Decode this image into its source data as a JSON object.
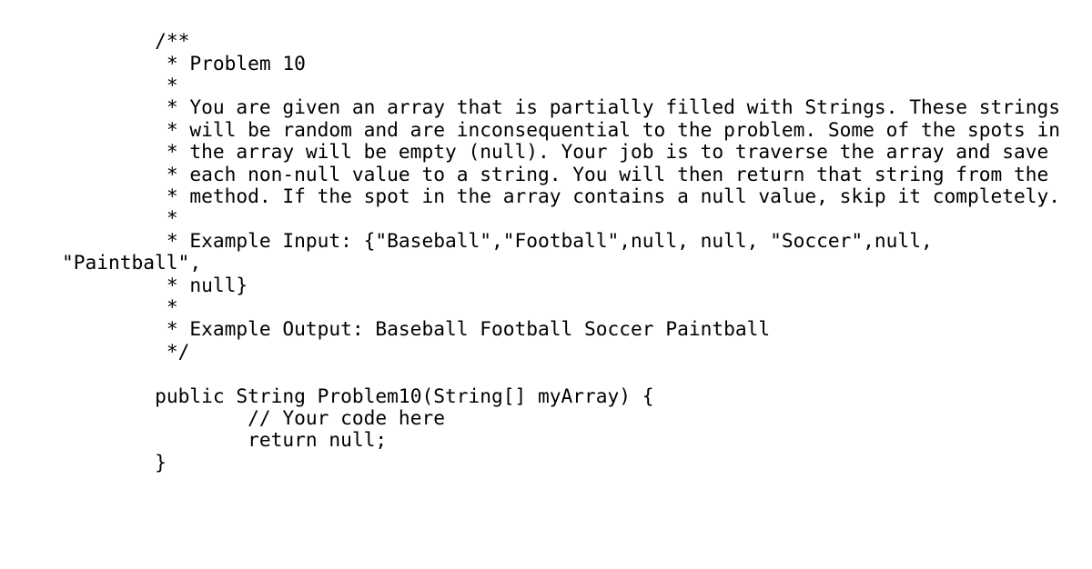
{
  "document": {
    "kind": "java-source-snippet",
    "language": "Java",
    "background_color": "#ffffff",
    "text_color": "#000000",
    "problem_title": "Problem 10",
    "method_signature": "public String Problem10(String[] myArray) {"
  },
  "code": {
    "lines": [
      "        /**",
      "         * Problem 10",
      "         *",
      "         * You are given an array that is partially filled with Strings. These strings",
      "         * will be random and are inconsequential to the problem. Some of the spots in",
      "         * the array will be empty (null). Your job is to traverse the array and save",
      "         * each non-null value to a string. You will then return that string from the",
      "         * method. If the spot in the array contains a null value, skip it completely.",
      "         *",
      "         * Example Input: {\"Baseball\",\"Football\",null, null, \"Soccer\",null, \"Paintball\",",
      "         * null}",
      "         *",
      "         * Example Output: Baseball Football Soccer Paintball",
      "         */",
      "",
      "        public String Problem10(String[] myArray) {",
      "                // Your code here",
      "                return null;",
      "        }"
    ]
  },
  "comment_block": {
    "open_token": "/**",
    "close_token": "*/",
    "title_line": "* Problem 10",
    "description": [
      "* You are given an array that is partially filled with Strings. These strings",
      "* will be random and are inconsequential to the problem. Some of the spots in",
      "* the array will be empty (null). Your job is to traverse the array and save",
      "* each non-null value to a string. You will then return that string from the",
      "* method. If the spot in the array contains a null value, skip it completely."
    ],
    "example_input_label": "Example Input:",
    "example_input_value": "{\"Baseball\",\"Football\",null, null, \"Soccer\",null, \"Paintball\", null}",
    "example_output_label": "Example Output:",
    "example_output_value": "Baseball Football Soccer Paintball"
  },
  "method_body": {
    "signature": "public String Problem10(String[] myArray) {",
    "comment": "// Your code here",
    "return_statement": "return null;",
    "closing_brace": "}"
  }
}
